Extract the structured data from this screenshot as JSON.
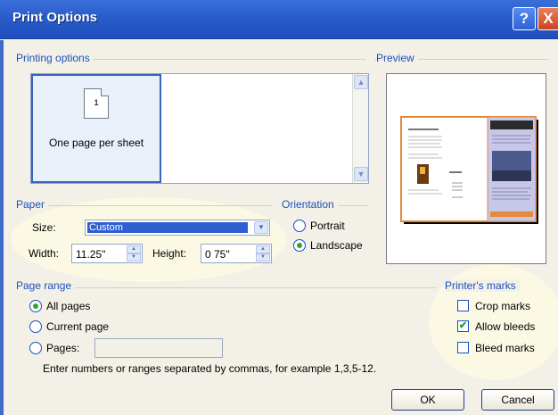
{
  "window": {
    "title": "Print Options",
    "help_label": "?",
    "close_label": "X"
  },
  "printing_options": {
    "group_label": "Printing options",
    "selected_option": "One page per sheet",
    "page_number": "1"
  },
  "preview": {
    "group_label": "Preview"
  },
  "paper": {
    "group_label": "Paper",
    "size_label": "Size:",
    "size_value": "Custom",
    "width_label": "Width:",
    "width_value": "11.25\"",
    "height_label": "Height:",
    "height_value": "0 75\""
  },
  "orientation": {
    "group_label": "Orientation",
    "portrait_label": "Portrait",
    "landscape_label": "Landscape",
    "selected": "Landscape"
  },
  "page_range": {
    "group_label": "Page range",
    "all_pages_label": "All pages",
    "current_page_label": "Current page",
    "pages_label": "Pages:",
    "pages_value": "",
    "selected": "All pages",
    "instructions": "Enter numbers or ranges separated by commas, for example 1,3,5-12."
  },
  "printers_marks": {
    "group_label": "Printer's marks",
    "crop_marks_label": "Crop marks",
    "crop_marks_checked": false,
    "allow_bleeds_label": "Allow bleeds",
    "allow_bleeds_checked": true,
    "bleed_marks_label": "Bleed marks",
    "bleed_marks_checked": false
  },
  "buttons": {
    "ok_label": "OK",
    "cancel_label": "Cancel"
  },
  "icons": {
    "page_icon": "page-icon",
    "scroll_up": "chevron-up-icon",
    "scroll_down": "chevron-down-icon",
    "dropdown": "chevron-down-icon",
    "spin_up": "arrow-up-icon",
    "spin_down": "arrow-down-icon",
    "check": "checkmark-icon"
  },
  "colors": {
    "titlebar": "#2a5ccc",
    "dialog_bg": "#f3f1e7",
    "group_label": "#1c4fbd",
    "highlight": "#fbf9e3",
    "selection": "#2e5fd0",
    "radio_dot": "#2fa82f",
    "brochure_border": "#e58a3a",
    "brochure_panel": "#c7c7ea"
  }
}
